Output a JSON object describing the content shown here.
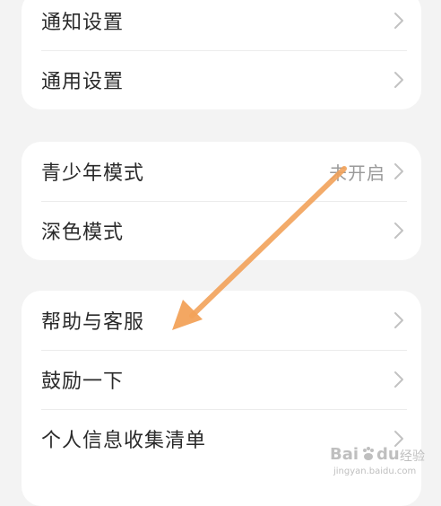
{
  "groups": [
    {
      "items": [
        {
          "label": "通知设置"
        },
        {
          "label": "通用设置"
        }
      ]
    },
    {
      "items": [
        {
          "label": "青少年模式",
          "value": "未开启"
        },
        {
          "label": "深色模式"
        }
      ]
    },
    {
      "items": [
        {
          "label": "帮助与客服"
        },
        {
          "label": "鼓励一下"
        },
        {
          "label": "个人信息收集清单"
        }
      ]
    }
  ],
  "watermark": {
    "brand": "Bai",
    "brand2": "du",
    "sub": "经验",
    "url": "jingyan.baidu.com"
  },
  "colors": {
    "background": "#f3f3f3",
    "card": "#ffffff",
    "text": "#2a2a2a",
    "secondary_text": "#9a9a9a",
    "chevron": "#c2c2c2",
    "annotation_arrow": "#f2a25a"
  },
  "icons": [
    "chevron-right-icon",
    "annotation-arrow-icon",
    "baidu-paw-icon"
  ]
}
